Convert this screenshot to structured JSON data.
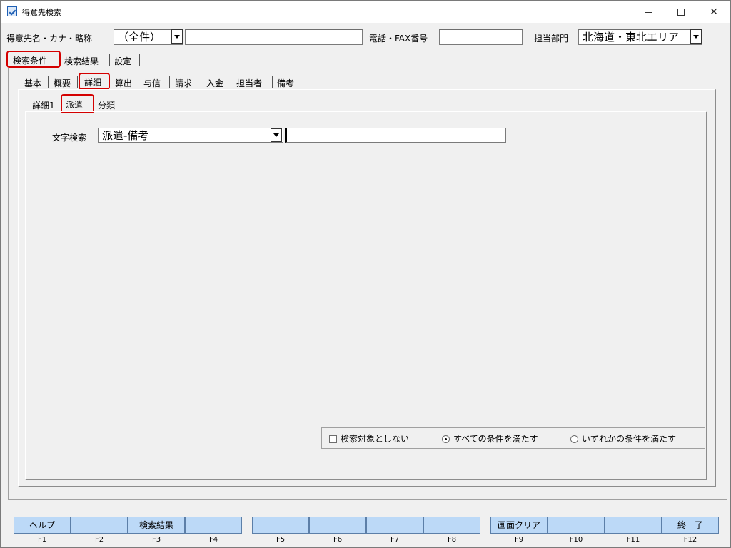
{
  "window": {
    "title": "得意先検索",
    "minimize_glyph": "",
    "maximize_glyph": "",
    "close_glyph": "✕"
  },
  "search": {
    "name_label": "得意先名・カナ・略称",
    "name_mode_value": "（全件）",
    "name_value": "",
    "phone_label": "電話・FAX番号",
    "phone_value": "",
    "dept_label": "担当部門",
    "dept_value": "北海道・東北エリア"
  },
  "top_tabs": [
    {
      "label": "検索条件",
      "selected": true
    },
    {
      "label": "検索結果",
      "selected": false
    },
    {
      "label": "設定",
      "selected": false
    }
  ],
  "second_tabs": [
    {
      "label": "基本",
      "selected": false
    },
    {
      "label": "概要",
      "selected": false
    },
    {
      "label": "詳細",
      "selected": true
    },
    {
      "label": "算出",
      "selected": false
    },
    {
      "label": "与信",
      "selected": false
    },
    {
      "label": "請求",
      "selected": false
    },
    {
      "label": "入金",
      "selected": false
    },
    {
      "label": "担当者",
      "selected": false
    },
    {
      "label": "備考",
      "selected": false
    }
  ],
  "third_tabs": [
    {
      "label": "詳細1",
      "selected": false
    },
    {
      "label": "派遣",
      "selected": true
    },
    {
      "label": "分類",
      "selected": false
    }
  ],
  "text_search": {
    "label": "文字検索",
    "field_value": "派遣-備考",
    "input_value": ""
  },
  "options": {
    "exclude_label": "検索対象としない",
    "exclude_checked": false,
    "all_label": "すべての条件を満たす",
    "all_selected": true,
    "any_label": "いずれかの条件を満たす",
    "any_selected": false
  },
  "function_keys": [
    {
      "key": "F1",
      "label": "ヘルプ"
    },
    {
      "key": "F2",
      "label": ""
    },
    {
      "key": "F3",
      "label": "検索結果"
    },
    {
      "key": "F4",
      "label": ""
    },
    {
      "key": "F5",
      "label": ""
    },
    {
      "key": "F6",
      "label": ""
    },
    {
      "key": "F7",
      "label": ""
    },
    {
      "key": "F8",
      "label": ""
    },
    {
      "key": "F9",
      "label": "画面クリア"
    },
    {
      "key": "F10",
      "label": ""
    },
    {
      "key": "F11",
      "label": ""
    },
    {
      "key": "F12",
      "label": "終　了"
    }
  ],
  "colors": {
    "highlight": "#d40000",
    "fkey_fill": "#bcd9f7"
  }
}
